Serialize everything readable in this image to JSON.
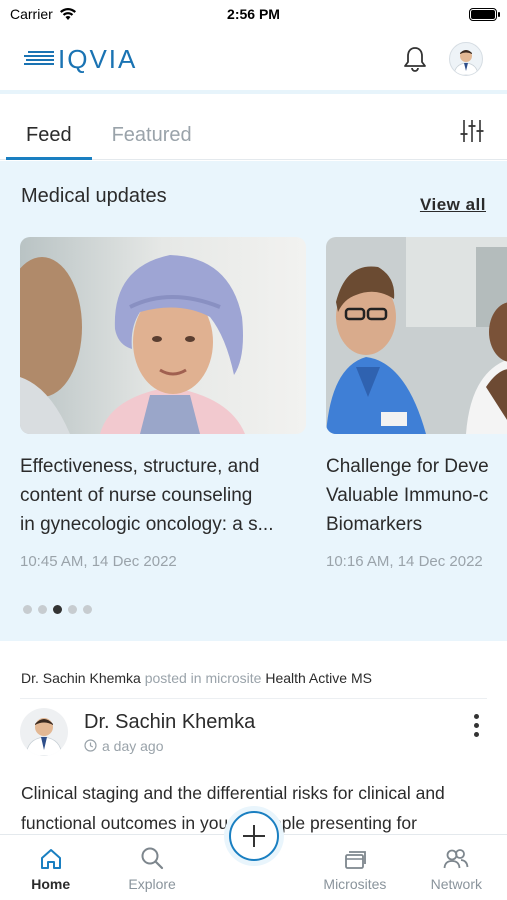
{
  "status_bar": {
    "carrier": "Carrier",
    "time": "2:56 PM"
  },
  "header": {
    "logo_text": "IQVIA"
  },
  "tabs": [
    {
      "label": "Feed",
      "active": true
    },
    {
      "label": "Featured",
      "active": false
    }
  ],
  "medical_updates": {
    "title": "Medical updates",
    "view_all": "View all",
    "cards": [
      {
        "title_lines": [
          "Effectiveness, structure, and",
          "content of nurse counseling",
          "in gynecologic oncology: a s..."
        ],
        "time": "10:45 AM, 14 Dec 2022"
      },
      {
        "title_lines": [
          "Challenge for Deve",
          "Valuable Immuno-c",
          "Biomarkers"
        ],
        "time": "10:16 AM, 14 Dec 2022"
      }
    ],
    "pagination": {
      "count": 5,
      "active_index": 2
    }
  },
  "post": {
    "meta_author": "Dr. Sachin Khemka",
    "meta_connector": "posted in microsite",
    "meta_microsite": "Health Active MS",
    "author_name": "Dr. Sachin Khemka",
    "time_ago": "a day ago",
    "body": "Clinical staging and the differential risks for clinical and functional outcomes in young people presenting for"
  },
  "bottom_nav": {
    "home": "Home",
    "explore": "Explore",
    "microsites": "Microsites",
    "network": "Network"
  },
  "colors": {
    "brand": "#1a73b3",
    "accent": "#1a7fc1",
    "section_bg": "#e9f5fc"
  }
}
